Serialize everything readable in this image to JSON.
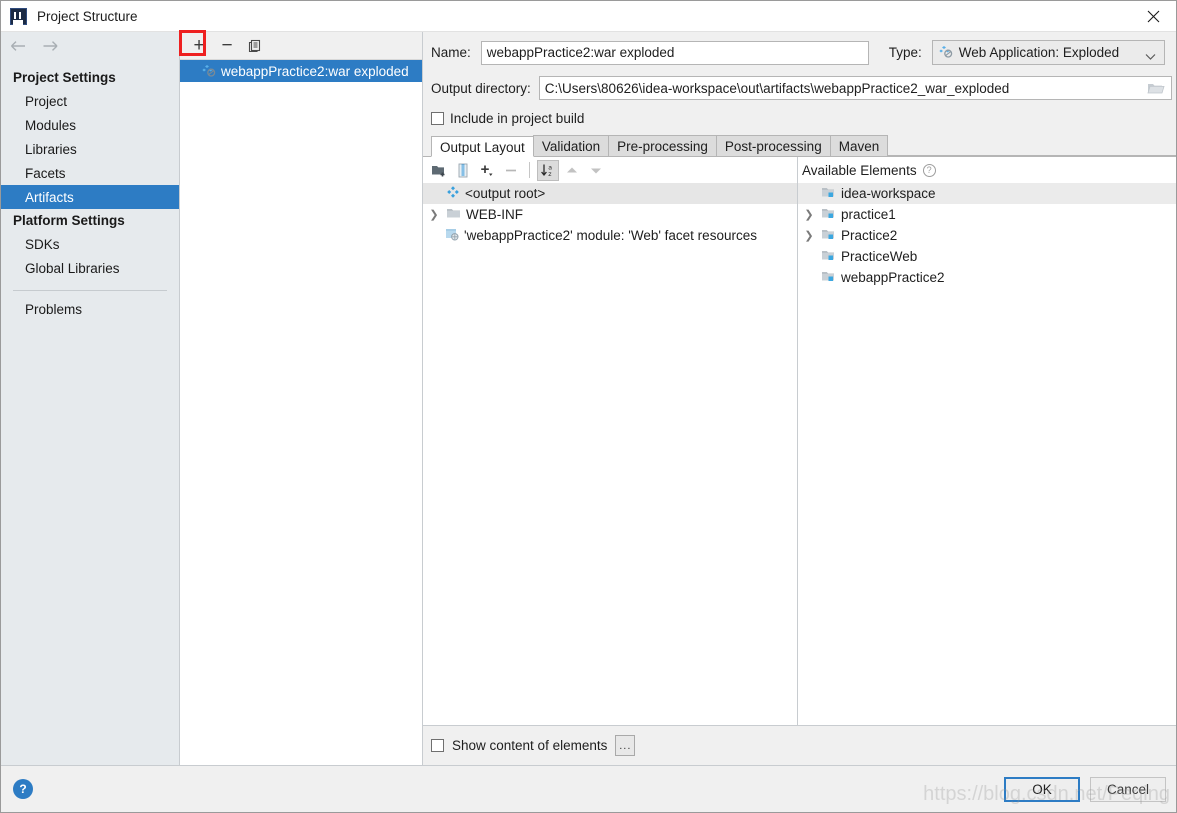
{
  "window": {
    "title": "Project Structure",
    "app_icon": "intellij-idea-icon",
    "close_icon": "close-icon"
  },
  "sidebar": {
    "nav": {
      "back_icon": "arrow-left-icon",
      "forward_icon": "arrow-right-icon"
    },
    "groups": [
      {
        "header": "Project Settings",
        "items": [
          {
            "label": "Project",
            "selected": false
          },
          {
            "label": "Modules",
            "selected": false
          },
          {
            "label": "Libraries",
            "selected": false
          },
          {
            "label": "Facets",
            "selected": false
          },
          {
            "label": "Artifacts",
            "selected": true
          }
        ]
      },
      {
        "header": "Platform Settings",
        "items": [
          {
            "label": "SDKs",
            "selected": false
          },
          {
            "label": "Global Libraries",
            "selected": false
          }
        ]
      }
    ],
    "problems": {
      "label": "Problems"
    }
  },
  "artifacts_panel": {
    "toolbar": {
      "add_label": "+",
      "add_icon": "plus-icon",
      "remove_label": "−",
      "remove_icon": "minus-icon",
      "copy_icon": "copy-icon"
    },
    "items": [
      {
        "label": "webappPractice2:war exploded",
        "icon": "artifact-icon",
        "selected": true
      }
    ]
  },
  "detail": {
    "name": {
      "label": "Name:",
      "value": "webappPractice2:war exploded"
    },
    "type": {
      "label": "Type:",
      "value": "Web Application: Exploded",
      "icon": "artifact-icon",
      "chevron_icon": "chevron-down-icon"
    },
    "output_directory": {
      "label": "Output directory:",
      "value": "C:\\Users\\80626\\idea-workspace\\out\\artifacts\\webappPractice2_war_exploded",
      "browse_icon": "folder-browse-icon"
    },
    "include_in_build": {
      "label": "Include in project build",
      "checked": false
    },
    "tabs": [
      {
        "label": "Output Layout",
        "active": true
      },
      {
        "label": "Validation",
        "active": false
      },
      {
        "label": "Pre-processing",
        "active": false
      },
      {
        "label": "Post-processing",
        "active": false
      },
      {
        "label": "Maven",
        "active": false
      }
    ],
    "output_layout": {
      "toolbar": [
        {
          "name": "add-directory-icon",
          "enabled": true,
          "pressed": false
        },
        {
          "name": "add-archive-icon",
          "enabled": true,
          "pressed": false
        },
        {
          "name": "add-element-icon",
          "enabled": true,
          "pressed": false
        },
        {
          "name": "remove-element-icon",
          "enabled": false,
          "pressed": false
        },
        {
          "name": "sort-alphabetically-icon",
          "enabled": true,
          "pressed": true
        },
        {
          "name": "move-up-icon",
          "enabled": false,
          "pressed": false
        },
        {
          "name": "move-down-icon",
          "enabled": false,
          "pressed": false
        }
      ],
      "tree": [
        {
          "label": "<output root>",
          "icon": "output-root-icon",
          "indent": 0,
          "twisty": "",
          "selected": true
        },
        {
          "label": "WEB-INF",
          "icon": "folder-icon",
          "indent": 1,
          "twisty": "collapsed",
          "selected": false
        },
        {
          "label": "'webappPractice2' module: 'Web' facet resources",
          "icon": "module-facet-icon",
          "indent": 1,
          "twisty": "",
          "selected": false
        }
      ]
    },
    "available_elements": {
      "title": "Available Elements",
      "help_icon": "help-icon",
      "tree": [
        {
          "label": "idea-workspace",
          "icon": "module-icon",
          "twisty": "",
          "selected": true
        },
        {
          "label": "practice1",
          "icon": "module-icon",
          "twisty": "collapsed",
          "selected": false
        },
        {
          "label": "Practice2",
          "icon": "module-icon",
          "twisty": "collapsed",
          "selected": false
        },
        {
          "label": "PracticeWeb",
          "icon": "module-icon",
          "twisty": "",
          "selected": false
        },
        {
          "label": "webappPractice2",
          "icon": "module-icon",
          "twisty": "",
          "selected": false
        }
      ]
    },
    "show_content": {
      "label": "Show content of elements",
      "checked": false,
      "more_button": "..."
    }
  },
  "footer": {
    "help_icon": "help-icon",
    "help_label": "?",
    "ok_label": "OK",
    "cancel_label": "Cancel"
  },
  "watermark": {
    "text": "https://blog.csdn.net/Peqing"
  },
  "colors": {
    "selection_blue": "#2d7cc4",
    "annotation_red": "#ee2020",
    "sidebar_bg": "#e6eaed",
    "panel_bg": "#f0f0f0"
  }
}
